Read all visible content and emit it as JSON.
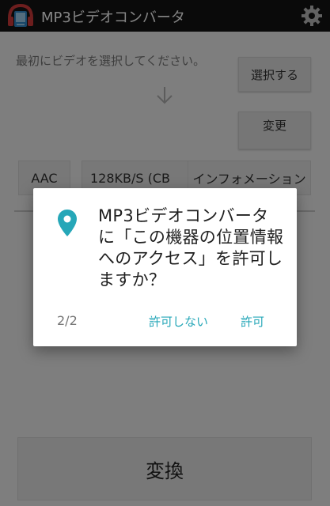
{
  "app": {
    "title": "MP3ビデオコンバータ",
    "logo_icon": "headphones-video-icon",
    "settings_icon": "gear-icon"
  },
  "main": {
    "instruction": "最初にビデオを選択してください。",
    "select_button": "選択する",
    "change_button": "変更",
    "arrow_icon": "arrow-down-icon",
    "format": "AAC",
    "bitrate": "128KB/S (CB",
    "info_button": "インフォメーション",
    "convert_button": "変換"
  },
  "dialog": {
    "message": "MP3ビデオコンバータ に「この機器の位置情報へのアクセス」を許可しますか？",
    "counter": "2/2",
    "deny": "許可しない",
    "allow": "許可",
    "icon": "location-pin-icon",
    "accent_color": "#26a7b8"
  }
}
